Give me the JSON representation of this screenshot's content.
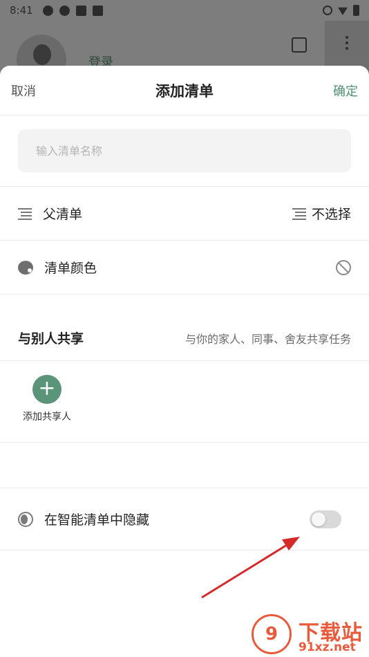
{
  "status_bar": {
    "time": "8:41"
  },
  "background": {
    "login_text": "登录"
  },
  "header": {
    "cancel_label": "取消",
    "title": "添加清单",
    "confirm_label": "确定"
  },
  "name_field": {
    "value": "",
    "placeholder": "输入清单名称"
  },
  "parent_list": {
    "label": "父清单",
    "value": "不选择",
    "icon": "list-icon"
  },
  "list_color": {
    "label": "清单颜色",
    "icon": "palette-icon",
    "value_icon": "no-color-icon"
  },
  "share": {
    "title": "与别人共享",
    "description": "与你的家人、同事、舍友共享任务",
    "add_label": "添加共享人"
  },
  "hide_smart": {
    "label": "在智能清单中隐藏",
    "toggle_on": false,
    "icon": "moon-icon"
  },
  "accent_color": "#5a9479",
  "watermark": {
    "title": "下载站",
    "url": "91xz.net",
    "logo_text": "9"
  }
}
